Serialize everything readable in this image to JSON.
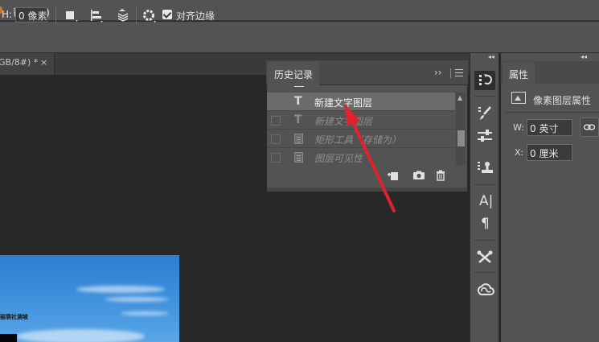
{
  "menubar": {
    "help_label": "帮助(H)"
  },
  "options_bar": {
    "h_label": "H:",
    "h_value": "0 像素",
    "align_edges_checked": true,
    "align_edges_label": "对齐边缘"
  },
  "document": {
    "tab_title": "GB/8#) *",
    "tab_close": "×",
    "canvas_caption": "丽衰社测坡"
  },
  "history_panel": {
    "title": "历史记录",
    "expand_glyph": "››",
    "items": [
      {
        "icon": "text-layer-icon",
        "label": "新建文字图层",
        "state": "active"
      },
      {
        "icon": "text-layer-icon",
        "label": "新建文字图层",
        "state": "dimmed"
      },
      {
        "icon": "document-icon",
        "label": "矩形工具（存储为）",
        "state": "dimmed"
      },
      {
        "icon": "document-icon",
        "label": "图层可见性",
        "state": "dimmed"
      }
    ]
  },
  "tool_strip": {
    "char_label": "A|",
    "para_label": "¶"
  },
  "properties_panel": {
    "title": "属性",
    "subtitle": "像素图层属性",
    "w_label": "W:",
    "w_value": "0 英寸",
    "x_label": "X:",
    "x_value": "0 厘米"
  },
  "colors": {
    "annotation_arrow": "#e0222a",
    "panel_bg": "#535353",
    "workspace_bg": "#282828"
  }
}
